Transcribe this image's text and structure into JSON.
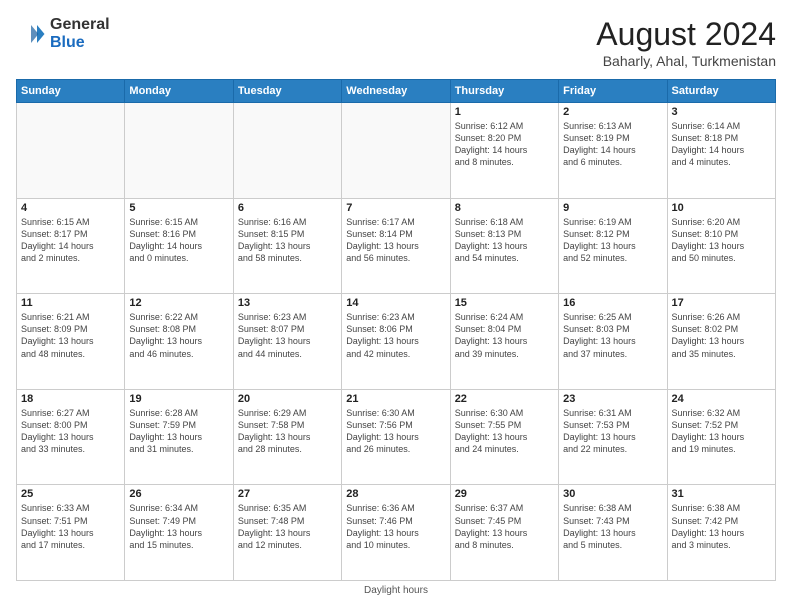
{
  "logo": {
    "general": "General",
    "blue": "Blue"
  },
  "title": {
    "month_year": "August 2024",
    "location": "Baharly, Ahal, Turkmenistan"
  },
  "days_of_week": [
    "Sunday",
    "Monday",
    "Tuesday",
    "Wednesday",
    "Thursday",
    "Friday",
    "Saturday"
  ],
  "footer": {
    "note": "Daylight hours"
  },
  "weeks": [
    [
      {
        "day": "",
        "info": ""
      },
      {
        "day": "",
        "info": ""
      },
      {
        "day": "",
        "info": ""
      },
      {
        "day": "",
        "info": ""
      },
      {
        "day": "1",
        "info": "Sunrise: 6:12 AM\nSunset: 8:20 PM\nDaylight: 14 hours\nand 8 minutes."
      },
      {
        "day": "2",
        "info": "Sunrise: 6:13 AM\nSunset: 8:19 PM\nDaylight: 14 hours\nand 6 minutes."
      },
      {
        "day": "3",
        "info": "Sunrise: 6:14 AM\nSunset: 8:18 PM\nDaylight: 14 hours\nand 4 minutes."
      }
    ],
    [
      {
        "day": "4",
        "info": "Sunrise: 6:15 AM\nSunset: 8:17 PM\nDaylight: 14 hours\nand 2 minutes."
      },
      {
        "day": "5",
        "info": "Sunrise: 6:15 AM\nSunset: 8:16 PM\nDaylight: 14 hours\nand 0 minutes."
      },
      {
        "day": "6",
        "info": "Sunrise: 6:16 AM\nSunset: 8:15 PM\nDaylight: 13 hours\nand 58 minutes."
      },
      {
        "day": "7",
        "info": "Sunrise: 6:17 AM\nSunset: 8:14 PM\nDaylight: 13 hours\nand 56 minutes."
      },
      {
        "day": "8",
        "info": "Sunrise: 6:18 AM\nSunset: 8:13 PM\nDaylight: 13 hours\nand 54 minutes."
      },
      {
        "day": "9",
        "info": "Sunrise: 6:19 AM\nSunset: 8:12 PM\nDaylight: 13 hours\nand 52 minutes."
      },
      {
        "day": "10",
        "info": "Sunrise: 6:20 AM\nSunset: 8:10 PM\nDaylight: 13 hours\nand 50 minutes."
      }
    ],
    [
      {
        "day": "11",
        "info": "Sunrise: 6:21 AM\nSunset: 8:09 PM\nDaylight: 13 hours\nand 48 minutes."
      },
      {
        "day": "12",
        "info": "Sunrise: 6:22 AM\nSunset: 8:08 PM\nDaylight: 13 hours\nand 46 minutes."
      },
      {
        "day": "13",
        "info": "Sunrise: 6:23 AM\nSunset: 8:07 PM\nDaylight: 13 hours\nand 44 minutes."
      },
      {
        "day": "14",
        "info": "Sunrise: 6:23 AM\nSunset: 8:06 PM\nDaylight: 13 hours\nand 42 minutes."
      },
      {
        "day": "15",
        "info": "Sunrise: 6:24 AM\nSunset: 8:04 PM\nDaylight: 13 hours\nand 39 minutes."
      },
      {
        "day": "16",
        "info": "Sunrise: 6:25 AM\nSunset: 8:03 PM\nDaylight: 13 hours\nand 37 minutes."
      },
      {
        "day": "17",
        "info": "Sunrise: 6:26 AM\nSunset: 8:02 PM\nDaylight: 13 hours\nand 35 minutes."
      }
    ],
    [
      {
        "day": "18",
        "info": "Sunrise: 6:27 AM\nSunset: 8:00 PM\nDaylight: 13 hours\nand 33 minutes."
      },
      {
        "day": "19",
        "info": "Sunrise: 6:28 AM\nSunset: 7:59 PM\nDaylight: 13 hours\nand 31 minutes."
      },
      {
        "day": "20",
        "info": "Sunrise: 6:29 AM\nSunset: 7:58 PM\nDaylight: 13 hours\nand 28 minutes."
      },
      {
        "day": "21",
        "info": "Sunrise: 6:30 AM\nSunset: 7:56 PM\nDaylight: 13 hours\nand 26 minutes."
      },
      {
        "day": "22",
        "info": "Sunrise: 6:30 AM\nSunset: 7:55 PM\nDaylight: 13 hours\nand 24 minutes."
      },
      {
        "day": "23",
        "info": "Sunrise: 6:31 AM\nSunset: 7:53 PM\nDaylight: 13 hours\nand 22 minutes."
      },
      {
        "day": "24",
        "info": "Sunrise: 6:32 AM\nSunset: 7:52 PM\nDaylight: 13 hours\nand 19 minutes."
      }
    ],
    [
      {
        "day": "25",
        "info": "Sunrise: 6:33 AM\nSunset: 7:51 PM\nDaylight: 13 hours\nand 17 minutes."
      },
      {
        "day": "26",
        "info": "Sunrise: 6:34 AM\nSunset: 7:49 PM\nDaylight: 13 hours\nand 15 minutes."
      },
      {
        "day": "27",
        "info": "Sunrise: 6:35 AM\nSunset: 7:48 PM\nDaylight: 13 hours\nand 12 minutes."
      },
      {
        "day": "28",
        "info": "Sunrise: 6:36 AM\nSunset: 7:46 PM\nDaylight: 13 hours\nand 10 minutes."
      },
      {
        "day": "29",
        "info": "Sunrise: 6:37 AM\nSunset: 7:45 PM\nDaylight: 13 hours\nand 8 minutes."
      },
      {
        "day": "30",
        "info": "Sunrise: 6:38 AM\nSunset: 7:43 PM\nDaylight: 13 hours\nand 5 minutes."
      },
      {
        "day": "31",
        "info": "Sunrise: 6:38 AM\nSunset: 7:42 PM\nDaylight: 13 hours\nand 3 minutes."
      }
    ]
  ]
}
